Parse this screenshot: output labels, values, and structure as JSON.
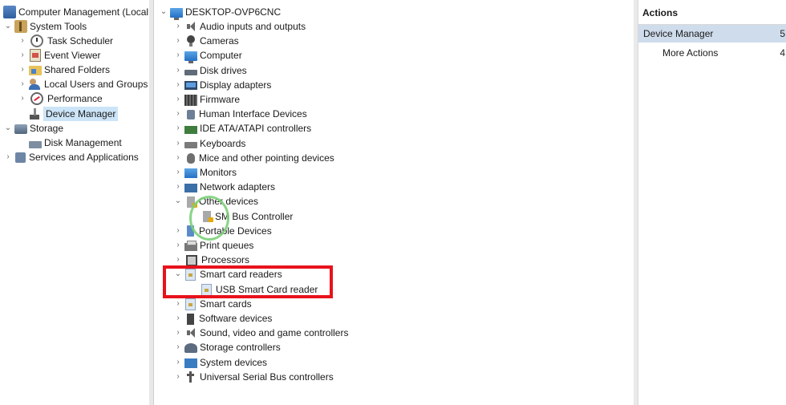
{
  "left_tree": {
    "root": "Computer Management (Local",
    "system_tools": "System Tools",
    "task_scheduler": "Task Scheduler",
    "event_viewer": "Event Viewer",
    "shared_folders": "Shared Folders",
    "local_users": "Local Users and Groups",
    "performance": "Performance",
    "device_manager": "Device Manager",
    "storage": "Storage",
    "disk_management": "Disk Management",
    "services": "Services and Applications"
  },
  "device_tree": {
    "computer_name": "DESKTOP-OVP6CNC",
    "categories": [
      {
        "label": "Audio inputs and outputs",
        "icon": "speaker-icon",
        "expanded": false
      },
      {
        "label": "Cameras",
        "icon": "camera-icon",
        "expanded": false
      },
      {
        "label": "Computer",
        "icon": "computer-icon",
        "expanded": false
      },
      {
        "label": "Disk drives",
        "icon": "disk-drive-icon",
        "expanded": false
      },
      {
        "label": "Display adapters",
        "icon": "display-adapter-icon",
        "expanded": false
      },
      {
        "label": "Firmware",
        "icon": "firmware-icon",
        "expanded": false
      },
      {
        "label": "Human Interface Devices",
        "icon": "hid-icon",
        "expanded": false
      },
      {
        "label": "IDE ATA/ATAPI controllers",
        "icon": "ide-controller-icon",
        "expanded": false
      },
      {
        "label": "Keyboards",
        "icon": "keyboard-icon",
        "expanded": false
      },
      {
        "label": "Mice and other pointing devices",
        "icon": "mouse-icon",
        "expanded": false
      },
      {
        "label": "Monitors",
        "icon": "monitor-icon",
        "expanded": false
      },
      {
        "label": "Network adapters",
        "icon": "network-adapter-icon",
        "expanded": false
      },
      {
        "label": "Other devices",
        "icon": "other-devices-icon",
        "expanded": true
      },
      {
        "label": "SM Bus Controller",
        "icon": "warning-device-icon",
        "child": true
      },
      {
        "label": "Portable Devices",
        "icon": "portable-device-icon",
        "expanded": false
      },
      {
        "label": "Print queues",
        "icon": "printer-icon",
        "expanded": false
      },
      {
        "label": "Processors",
        "icon": "processor-icon",
        "expanded": false
      },
      {
        "label": "Smart card readers",
        "icon": "smart-card-reader-icon",
        "expanded": true
      },
      {
        "label": "USB Smart Card reader",
        "icon": "smart-card-reader-icon",
        "child": true
      },
      {
        "label": "Smart cards",
        "icon": "smart-card-icon",
        "expanded": false
      },
      {
        "label": "Software devices",
        "icon": "software-device-icon",
        "expanded": false
      },
      {
        "label": "Sound, video and game controllers",
        "icon": "sound-icon",
        "expanded": false
      },
      {
        "label": "Storage controllers",
        "icon": "storage-controller-icon",
        "expanded": false
      },
      {
        "label": "System devices",
        "icon": "system-device-icon",
        "expanded": false
      },
      {
        "label": "Universal Serial Bus controllers",
        "icon": "usb-icon",
        "expanded": false
      }
    ]
  },
  "actions": {
    "header": "Actions",
    "device_manager": "Device Manager",
    "device_manager_arrow": "5",
    "more_actions": "More Actions",
    "more_actions_arrow": "4"
  },
  "colors": {
    "selection": "#cce4f7",
    "actions_selection": "#cfdcec",
    "highlight": "#e8121c",
    "cursor_ring": "#7cd079"
  }
}
